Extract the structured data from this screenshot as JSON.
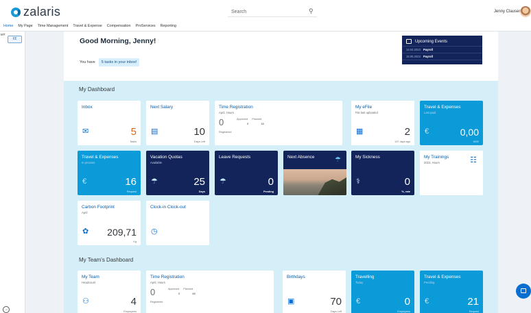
{
  "header": {
    "brand": "zalaris",
    "search_placeholder": "Search",
    "user_name": "Jenny Clausen"
  },
  "nav": [
    "Home",
    "My Page",
    "Time Management",
    "Travel & Expense",
    "Compensation",
    "ProServices",
    "Reporting"
  ],
  "left_rail": {
    "mt_label": "MT",
    "mt_icon_label": "€€"
  },
  "greeting": {
    "title": "Good Morning, Jenny!",
    "inbox_prefix": "You have",
    "inbox_chip": "5 tasks in your inbox!"
  },
  "events": {
    "title": "Upcoming Events",
    "items": [
      {
        "date": "14.04.2023",
        "name": "Payroll"
      },
      {
        "date": "15.05.2023",
        "name": "Payroll"
      }
    ]
  },
  "dashboard": {
    "title": "My Dashboard",
    "inbox": {
      "title": "Inbox",
      "value": "5",
      "foot": "Tasks",
      "icon": "mail-icon"
    },
    "salary": {
      "title": "Next Salary",
      "value": "10",
      "foot": "Days Left",
      "icon": "money-icon"
    },
    "time_reg": {
      "title": "Time Registration",
      "sub": "April, Hours",
      "zero": "0",
      "approved_label": "Approved",
      "planned_label": "Planned",
      "approved": "0",
      "planned": "16",
      "registered_label": "Registered"
    },
    "efile": {
      "title": "My eFile",
      "sub": "File last uploaded",
      "value": "2",
      "foot": "137 days ago",
      "icon": "file-icon"
    },
    "travel_last": {
      "title": "Travel & Expenses",
      "sub": "Last paid",
      "value": "0,00",
      "foot": "NOK",
      "icon": "euro-icon"
    },
    "travel_process": {
      "title": "Travel & Expenses",
      "sub": "In process",
      "value": "16",
      "foot": "Request",
      "icon": "euro-icon"
    },
    "vacation": {
      "title": "Vacation Quotas",
      "sub": "Available",
      "value": "25",
      "foot": "Days",
      "icon": "beach-icon"
    },
    "leave": {
      "title": "Leave Requests",
      "value": "0",
      "foot": "Pending",
      "icon": "beach-icon"
    },
    "absence": {
      "title": "Next Absence",
      "icon": "umbrella-icon"
    },
    "sickness": {
      "title": "My Sickness",
      "value": "0",
      "foot": "%, rate",
      "icon": "sick-icon"
    },
    "trainings": {
      "title": "My Trainings",
      "sub": "2023, Hours",
      "icon": "book-icon"
    },
    "carbon": {
      "title": "Carbon Footprint",
      "sub": "April",
      "value": "209,71",
      "foot": "Kg",
      "icon": "leaf-icon"
    },
    "clock": {
      "title": "Clock-in Clock-out",
      "icon": "clock-user-icon"
    }
  },
  "team": {
    "title": "My Team's Dashboard",
    "my_team": {
      "title": "My Team",
      "sub": "Headcount",
      "value": "4",
      "foot": "Employees",
      "icon": "team-icon"
    },
    "time_reg": {
      "title": "Time Registration",
      "sub": "April, Hours",
      "zero": "0",
      "approved_label": "Approved",
      "planned_label": "Planned",
      "approved": "0",
      "planned": "48",
      "registered_label": "Registered"
    },
    "birthdays": {
      "title": "Birthdays",
      "value": "70",
      "foot": "Days Left",
      "icon": "cake-icon"
    },
    "travelling": {
      "title": "Travelling",
      "sub": "Today",
      "value": "0",
      "foot": "Employees",
      "icon": "euro-icon"
    },
    "travel_pending": {
      "title": "Travel & Expenses",
      "sub": "Pending",
      "value": "21",
      "foot": "Request",
      "icon": "euro-icon"
    }
  },
  "colors": {
    "dark_tile": "#13245a",
    "blue_tile": "#0a9bd8",
    "dash_bg": "#d5eff9",
    "accent": "#0a6ed1"
  }
}
